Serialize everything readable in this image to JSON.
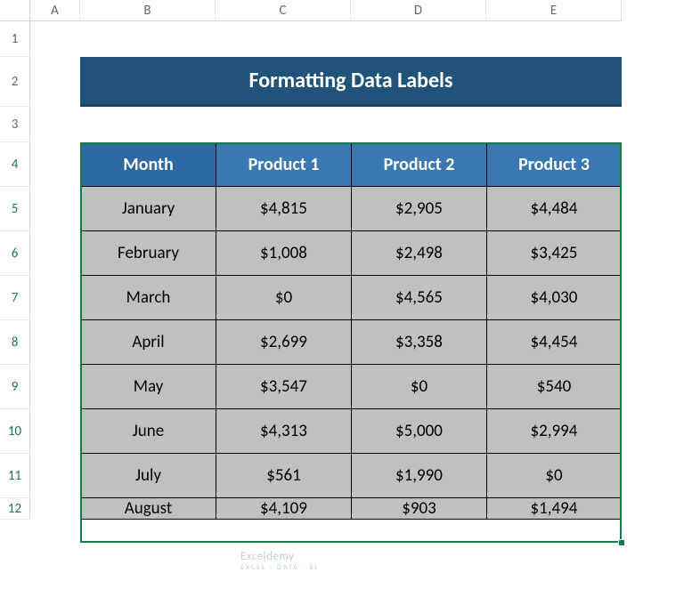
{
  "colHeaders": [
    "A",
    "B",
    "C",
    "D",
    "E"
  ],
  "rowHeaders": [
    "1",
    "2",
    "3",
    "4",
    "5",
    "6",
    "7",
    "8",
    "9",
    "10",
    "11",
    "12"
  ],
  "title": "Formatting Data Labels",
  "table": {
    "headers": [
      "Month",
      "Product 1",
      "Product 2",
      "Product 3"
    ],
    "rows": [
      [
        "January",
        "$4,815",
        "$2,905",
        "$4,484"
      ],
      [
        "February",
        "$1,008",
        "$2,498",
        "$3,425"
      ],
      [
        "March",
        "$0",
        "$4,565",
        "$4,030"
      ],
      [
        "April",
        "$2,699",
        "$3,358",
        "$4,454"
      ],
      [
        "May",
        "$3,547",
        "$0",
        "$540"
      ],
      [
        "June",
        "$4,313",
        "$5,000",
        "$2,994"
      ],
      [
        "July",
        "$561",
        "$1,990",
        "$0"
      ],
      [
        "August",
        "$4,109",
        "$903",
        "$1,494"
      ]
    ]
  },
  "watermark": {
    "main": "Exceldemy",
    "sub": "EXCEL · DATA · BI"
  },
  "chart_data": {
    "type": "table",
    "title": "Formatting Data Labels",
    "categories": [
      "January",
      "February",
      "March",
      "April",
      "May",
      "June",
      "July",
      "August"
    ],
    "series": [
      {
        "name": "Product 1",
        "values": [
          4815,
          1008,
          0,
          2699,
          3547,
          4313,
          561,
          4109
        ]
      },
      {
        "name": "Product 2",
        "values": [
          2905,
          2498,
          4565,
          3358,
          0,
          5000,
          1990,
          903
        ]
      },
      {
        "name": "Product 3",
        "values": [
          4484,
          3425,
          4030,
          4454,
          540,
          2994,
          0,
          1494
        ]
      }
    ],
    "xlabel": "Month",
    "ylabel": ""
  }
}
